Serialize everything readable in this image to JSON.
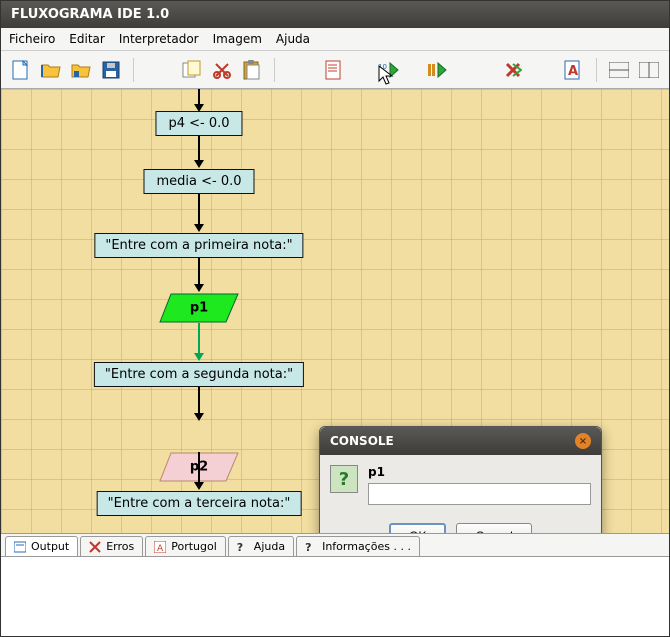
{
  "title": "FLUXOGRAMA IDE 1.0",
  "menu": {
    "file": "Ficheiro",
    "edit": "Editar",
    "interpreter": "Interpretador",
    "image": "Imagem",
    "help": "Ajuda"
  },
  "toolbar": {
    "new": "new-file-icon",
    "open": "open-folder-icon",
    "save": "save-icon",
    "save_as": "diskette-icon",
    "copy": "copy-icon",
    "cut": "scissors-icon",
    "paste": "paste-icon",
    "doc": "document-icon",
    "run": "run-icon",
    "step": "step-icon",
    "stop": "stop-icon",
    "style": "style-icon",
    "split_h": "split-h-icon",
    "split_v": "split-v-icon"
  },
  "flow": {
    "assign1": "p4 <- 0.0",
    "assign2": "media <- 0.0",
    "out1": "\"Entre com a primeira nota:\"",
    "in1": "p1",
    "out2": "\"Entre com a segunda nota:\"",
    "in2": "p2",
    "out3": "\"Entre com a terceira nota:\""
  },
  "tabs": {
    "output": "Output",
    "errors": "Erros",
    "portugol": "Portugol",
    "help": "Ajuda",
    "info": "Informações . . ."
  },
  "dialog": {
    "title": "CONSOLE",
    "prompt": "p1",
    "input": "",
    "ok": "OK",
    "cancel": "Cancel"
  }
}
